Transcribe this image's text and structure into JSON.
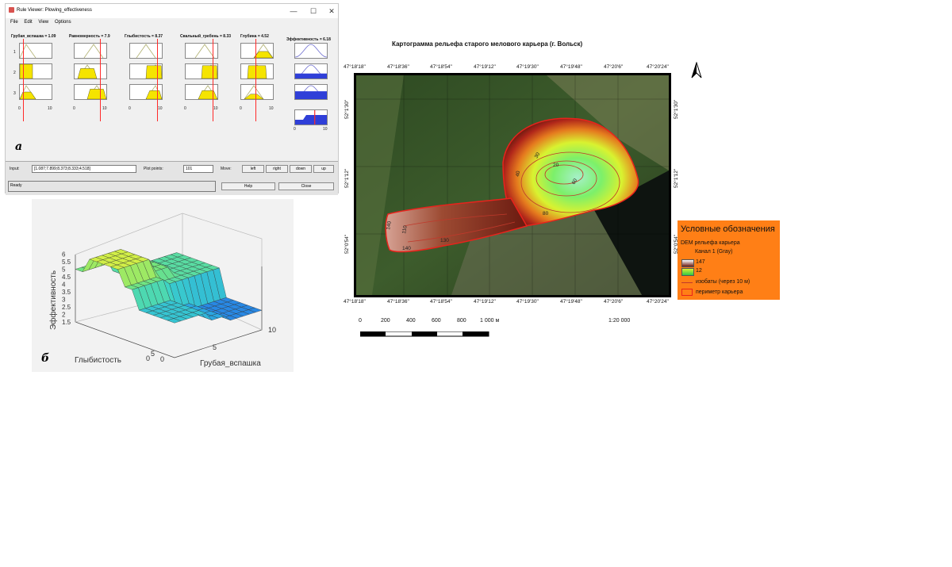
{
  "rule_viewer": {
    "title": "Rule Viewer: Plowing_effectiveness",
    "menu": [
      "File",
      "Edit",
      "View",
      "Options"
    ],
    "window_buttons": {
      "minimize": "—",
      "maximize": "☐",
      "close": "✕"
    },
    "inputs": [
      {
        "label": "Грубая_вспашка = 1.09",
        "value": 1.09
      },
      {
        "label": "Равномерность = 7.9",
        "value": 7.9
      },
      {
        "label": "Глыбистость = 8.37",
        "value": 8.37
      },
      {
        "label": "Свальный_гребень = 8.33",
        "value": 8.33
      },
      {
        "label": "Глубина = 4.52",
        "value": 4.52
      }
    ],
    "output": {
      "label": "Эффективность = 6.18",
      "value": 6.18
    },
    "rows": [
      "1",
      "2",
      "3"
    ],
    "axis_min": "0",
    "axis_max": "10",
    "input_label": "Input:",
    "input_value": "[1.087;7.899;8.373;8.333;4.518]",
    "plot_points_label": "Plot points:",
    "plot_points_value": "101",
    "move_label": "Move:",
    "move_buttons": [
      "left",
      "right",
      "down",
      "up"
    ],
    "status": "Ready",
    "help_button": "Help",
    "close_button": "Close",
    "colors": {
      "fill_input": "#f5e400",
      "fill_output": "#2f3fd8",
      "line": "#ff2a2a"
    }
  },
  "figure_labels": {
    "a": "а",
    "b": "б"
  },
  "surface": {
    "zlabel": "Эффективность",
    "xlabel": "Глыбистость",
    "ylabel": "Грубая_вспашка",
    "z_ticks": [
      "1.5",
      "2",
      "2.5",
      "3",
      "3.5",
      "4",
      "4.5",
      "5",
      "5.5",
      "6"
    ],
    "x_ticks": [
      "0",
      "5"
    ],
    "y_ticks": [
      "0",
      "5",
      "10"
    ]
  },
  "map": {
    "title": "Картограмма рельефа старого мелового карьера (г. Вольск)",
    "top_coords": [
      "47°18'18\"",
      "47°18'36\"",
      "47°18'54\"",
      "47°19'12\"",
      "47°19'30\"",
      "47°19'48\"",
      "47°20'6\"",
      "47°20'24\""
    ],
    "bottom_coords": [
      "47°18'18\"",
      "47°18'36\"",
      "47°18'54\"",
      "47°19'12\"",
      "47°19'30\"",
      "47°19'48\"",
      "47°20'6\"",
      "47°20'24\""
    ],
    "side_coords": [
      "52°1'30\"",
      "52°1'12\"",
      "52°0'54\""
    ],
    "contour_labels": [
      "20",
      "30",
      "40",
      "140",
      "110",
      "130",
      "60",
      "50",
      "80"
    ],
    "north": "north-arrow",
    "scale_ticks": [
      "0",
      "200",
      "400",
      "600",
      "800",
      "1 000 м"
    ],
    "scale_ratio": "1:20 000"
  },
  "legend": {
    "title": "Условные обозначения",
    "layer": "DEM рельефа карьера",
    "band": "Канал 1 (Gray)",
    "max": "147",
    "min": "12",
    "isolines": "изобаты (через 10 м)",
    "perimeter": "периметр карьера",
    "colors": {
      "bg": "#ff7f16",
      "perimeter": "#e8231c"
    }
  }
}
